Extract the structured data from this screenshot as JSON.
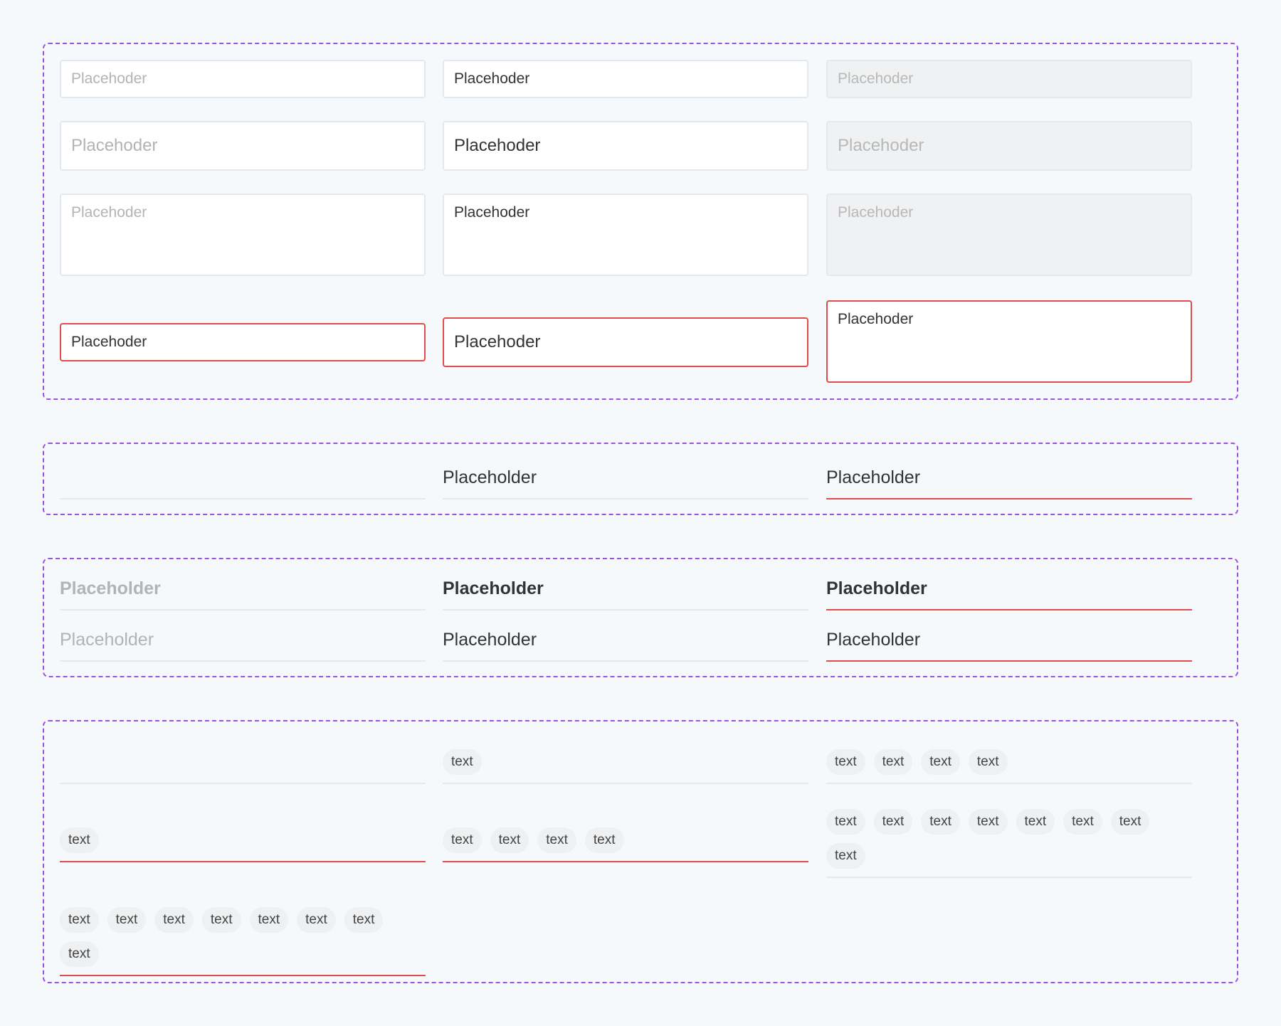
{
  "colors": {
    "background": "#f5f9fc",
    "group_border": "#9b51e0",
    "error": "#e04b4b",
    "tag_background": "#eef0f2"
  },
  "boxed_inputs": {
    "small_empty": "Placehoder",
    "small_filled": "Placehoder",
    "small_disabled": "Placehoder",
    "large_empty": "Placehoder",
    "large_filled": "Placehoder",
    "large_disabled": "Placehoder",
    "textarea_empty": "Placehoder",
    "textarea_filled": "Placehoder",
    "textarea_disabled": "Placehoder",
    "error_small": "Placehoder",
    "error_large": "Placehoder",
    "error_textarea": "Placehoder"
  },
  "underline_inputs": {
    "empty": "",
    "filled": "Placeholder",
    "error": "Placeholder"
  },
  "underline_pairs": {
    "bold_muted": "Placeholder",
    "bold_filled": "Placeholder",
    "bold_error": "Placeholder",
    "regular_muted": "Placeholder",
    "regular_filled": "Placeholder",
    "regular_error": "Placeholder"
  },
  "tag_fields": {
    "tag_label": "text",
    "counts": {
      "empty_default": 0,
      "single_error": 1,
      "many_error": 8,
      "single_default": 1,
      "four_error": 4,
      "four_default": 4,
      "many_default": 8
    }
  }
}
